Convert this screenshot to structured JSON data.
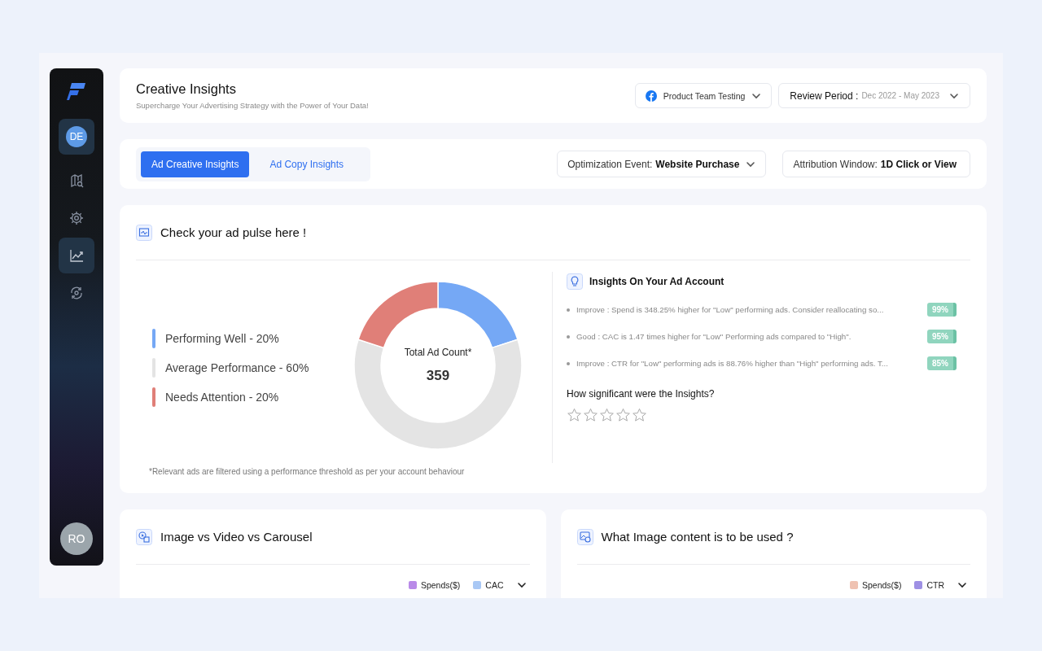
{
  "sidebar": {
    "user": {
      "initials": "DE",
      "selected": true
    },
    "items": [
      {
        "kind": "map",
        "selected": false
      },
      {
        "kind": "gear",
        "selected": false
      },
      {
        "kind": "trend",
        "selected": true
      },
      {
        "kind": "refresh",
        "selected": false
      }
    ],
    "bottom_user": {
      "initials": "RO"
    }
  },
  "header": {
    "title": "Creative Insights",
    "subtitle": "Supercharge Your Advertising Strategy with the Power of Your Data!",
    "account": "Product Team Testing",
    "period_label": "Review Period :",
    "period_value": "Dec 2022 - May 2023"
  },
  "tabs": [
    {
      "label": "Ad Creative Insights",
      "selected": true
    },
    {
      "label": "Ad Copy Insights",
      "selected": false
    }
  ],
  "filters": [
    {
      "label": "Optimization Event:",
      "value": "Website Purchase",
      "dropdown": true
    },
    {
      "label": "Attribution Window:",
      "value": "1D Click or View",
      "dropdown": false
    }
  ],
  "pulse": {
    "title": "Check your ad pulse here !",
    "legend": [
      {
        "label": "Performing Well - 20%",
        "color": "#75a8f5"
      },
      {
        "label": "Average Performance - 60%",
        "color": "#e4e4e4"
      },
      {
        "label": "Needs Attention - 20%",
        "color": "#e07f78"
      }
    ],
    "center_label": "Total Ad Count*",
    "center_value": "359",
    "chart_data": {
      "type": "donut",
      "values": [
        20,
        60,
        20
      ]
    },
    "footnote": "*Relevant ads are filtered using a performance threshold as per your account behaviour",
    "insights_title": "Insights On Your Ad Account",
    "insights": [
      {
        "text": "Improve : Spend is 348.25% higher for \"Low\" performing ads. Consider reallocating so...",
        "score": "99%"
      },
      {
        "text": "Good : CAC is 1.47 times higher for \"Low\" Performing ads compared to \"High\".",
        "score": "95%"
      },
      {
        "text": "Improve : CTR for \"Low\" performing ads is 88.76% higher than \"High\" performing ads. T...",
        "score": "85%"
      }
    ],
    "rating_question": "How significant were the Insights?",
    "stars": 0
  },
  "cards": [
    {
      "title": "Image vs Video vs Carousel",
      "kind": "media",
      "legend": [
        {
          "label": "Spends($)",
          "color": "#b98ae8"
        },
        {
          "label": "CAC",
          "color": "#a9c8f5"
        }
      ]
    },
    {
      "title": "What Image content is to be used ?",
      "kind": "image",
      "legend": [
        {
          "label": "Spends($)",
          "color": "#efc2b2"
        },
        {
          "label": "CTR",
          "color": "#9e90e4"
        }
      ]
    }
  ]
}
